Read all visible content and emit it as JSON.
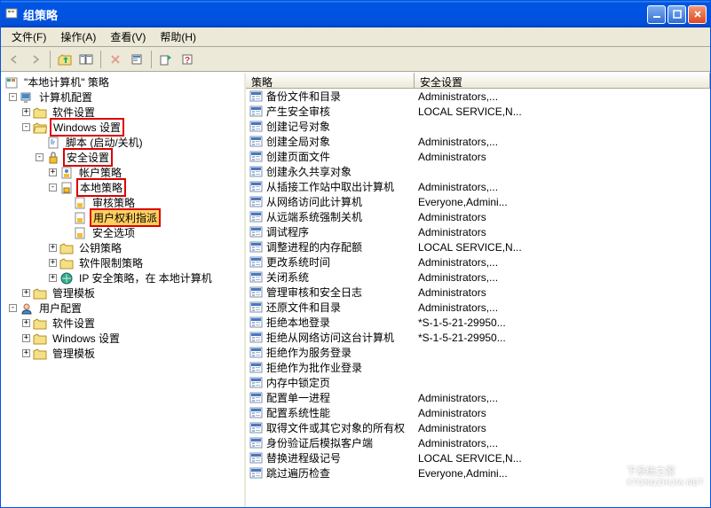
{
  "window": {
    "title": "组策略"
  },
  "menu": {
    "file": "文件(F)",
    "action": "操作(A)",
    "view": "查看(V)",
    "help": "帮助(H)"
  },
  "tree": {
    "root": "\"本地计算机\" 策略",
    "computer_config": "计算机配置",
    "software_settings": "软件设置",
    "windows_settings": "Windows 设置",
    "scripts": "脚本 (启动/关机)",
    "security_settings": "安全设置",
    "account_policy": "帐户策略",
    "local_policy": "本地策略",
    "audit_policy": "审核策略",
    "user_rights": "用户权利指派",
    "security_options": "安全选项",
    "public_key": "公钥策略",
    "software_restrict": "软件限制策略",
    "ip_security": "IP 安全策略，在 本地计算机",
    "admin_templates": "管理模板",
    "user_config": "用户配置",
    "software_settings2": "软件设置",
    "windows_settings2": "Windows 设置",
    "admin_templates2": "管理模板"
  },
  "list": {
    "col_policy": "策略",
    "col_setting": "安全设置",
    "rows": [
      {
        "policy": "备份文件和目录",
        "setting": "Administrators,..."
      },
      {
        "policy": "产生安全审核",
        "setting": "LOCAL SERVICE,N..."
      },
      {
        "policy": "创建记号对象",
        "setting": ""
      },
      {
        "policy": "创建全局对象",
        "setting": "Administrators,..."
      },
      {
        "policy": "创建页面文件",
        "setting": "Administrators"
      },
      {
        "policy": "创建永久共享对象",
        "setting": ""
      },
      {
        "policy": "从插接工作站中取出计算机",
        "setting": "Administrators,..."
      },
      {
        "policy": "从网络访问此计算机",
        "setting": "Everyone,Admini..."
      },
      {
        "policy": "从远端系统强制关机",
        "setting": "Administrators"
      },
      {
        "policy": "调试程序",
        "setting": "Administrators"
      },
      {
        "policy": "调整进程的内存配额",
        "setting": "LOCAL SERVICE,N..."
      },
      {
        "policy": "更改系统时间",
        "setting": "Administrators,..."
      },
      {
        "policy": "关闭系统",
        "setting": "Administrators,..."
      },
      {
        "policy": "管理审核和安全日志",
        "setting": "Administrators"
      },
      {
        "policy": "还原文件和目录",
        "setting": "Administrators,..."
      },
      {
        "policy": "拒绝本地登录",
        "setting": "*S-1-5-21-29950..."
      },
      {
        "policy": "拒绝从网络访问这台计算机",
        "setting": "*S-1-5-21-29950..."
      },
      {
        "policy": "拒绝作为服务登录",
        "setting": ""
      },
      {
        "policy": "拒绝作为批作业登录",
        "setting": ""
      },
      {
        "policy": "内存中锁定页",
        "setting": ""
      },
      {
        "policy": "配置单一进程",
        "setting": "Administrators,..."
      },
      {
        "policy": "配置系统性能",
        "setting": "Administrators"
      },
      {
        "policy": "取得文件或其它对象的所有权",
        "setting": "Administrators"
      },
      {
        "policy": "身份验证后模拟客户端",
        "setting": "Administrators,..."
      },
      {
        "policy": "替换进程级记号",
        "setting": "LOCAL SERVICE,N..."
      },
      {
        "policy": "跳过遍历检查",
        "setting": "Everyone,Admini..."
      }
    ]
  },
  "watermark": {
    "text_top": "下系统之家",
    "text_bottom": "XTONGZHIJIA.NET"
  }
}
